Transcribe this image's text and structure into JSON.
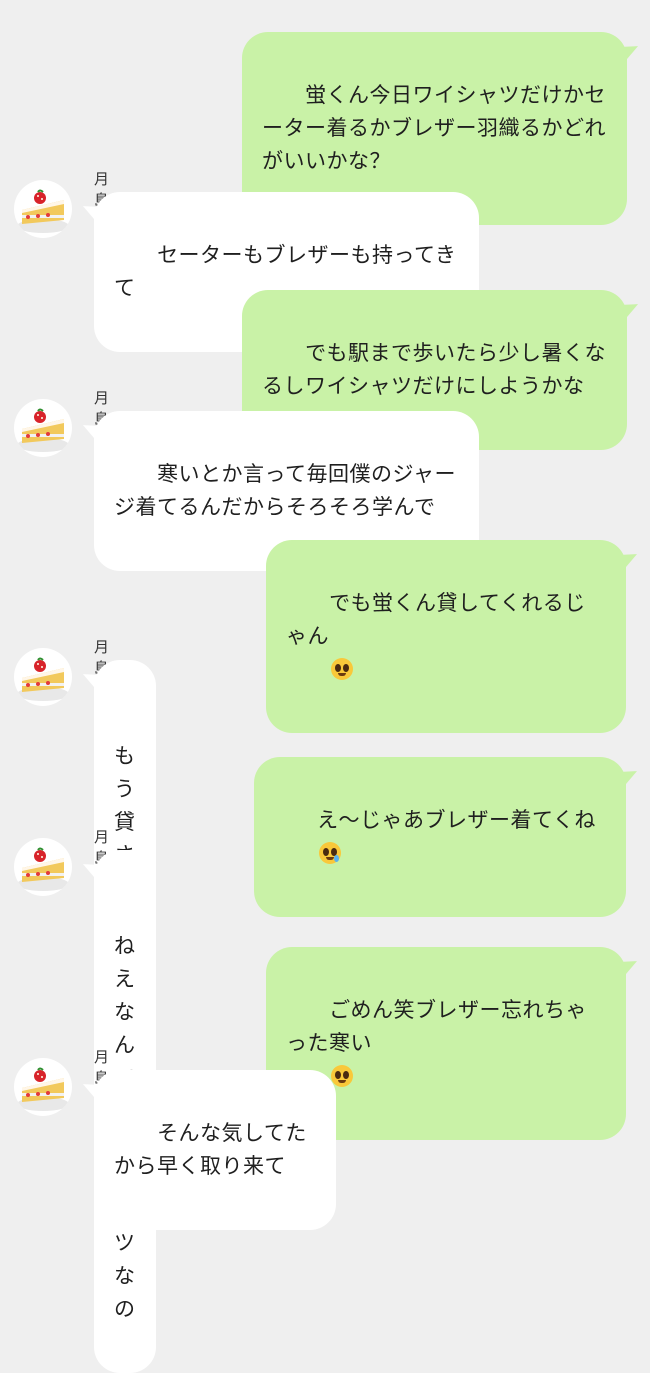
{
  "contact": {
    "name": "月島蛍",
    "avatar_icon": "strawberry-shortcake-icon"
  },
  "messages": [
    {
      "dir": "out",
      "text": "蛍くん今日ワイシャツだけかセーター着るかブレザー羽織るかどれがいいかな？"
    },
    {
      "dir": "in",
      "text": "セーターもブレザーも持ってきて"
    },
    {
      "dir": "out",
      "text": "でも駅まで歩いたら少し暑くなるしワイシャツだけにしようかな"
    },
    {
      "dir": "in",
      "text": "寒いとか言って毎回僕のジャージ着てるんだからそろそろ学んで"
    },
    {
      "dir": "out",
      "text": "でも蛍くん貸してくれるじゃん",
      "emoji": "pleading-face-emoji"
    },
    {
      "dir": "in",
      "text": "もう貸さない"
    },
    {
      "dir": "out",
      "text": "え〜じゃあブレザー着てくね",
      "emoji": "tearful-smile-emoji"
    },
    {
      "dir": "in",
      "text": "ねえなんでワイシャツなの"
    },
    {
      "dir": "out",
      "text": "ごめん笑ブレザー忘れちゃった寒い",
      "emoji": "pleading-face-emoji"
    },
    {
      "dir": "in",
      "text": "そんな気してたから早く取り来て"
    }
  ],
  "colors": {
    "background": "#efefef",
    "outgoing_bubble": "#c9f2a7",
    "incoming_bubble": "#ffffff"
  }
}
